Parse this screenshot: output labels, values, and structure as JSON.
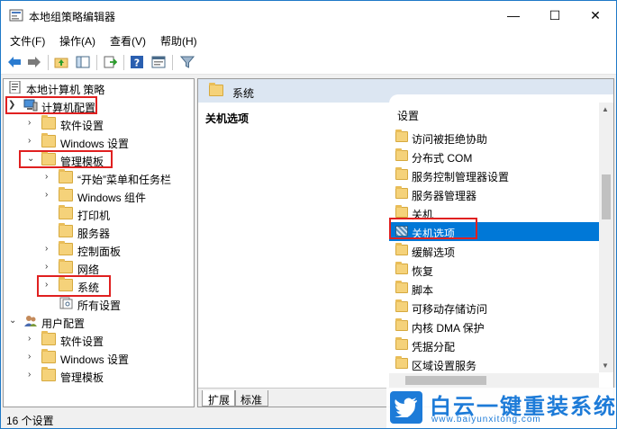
{
  "window": {
    "title": "本地组策略编辑器",
    "minimize": "—",
    "maximize": "☐",
    "close": "✕"
  },
  "menu": [
    "文件(F)",
    "操作(A)",
    "查看(V)",
    "帮助(H)"
  ],
  "toolbar": {
    "icons": [
      "back-icon",
      "forward-icon",
      "up-folder-icon",
      "show-hide-tree-icon",
      "export-list-icon",
      "help-icon",
      "properties-icon",
      "filter-icon"
    ]
  },
  "tree": {
    "root": "本地计算机 策略",
    "computer_config": "计算机配置",
    "software_settings": "软件设置",
    "windows_settings": "Windows 设置",
    "admin_templates": "管理模板",
    "start_menu": "“开始”菜单和任务栏",
    "windows_components": "Windows 组件",
    "printers": "打印机",
    "server": "服务器",
    "control_panel": "控制面板",
    "network": "网络",
    "system": "系统",
    "all_settings": "所有设置",
    "user_config": "用户配置",
    "user_software_settings": "软件设置",
    "user_windows_settings": "Windows 设置",
    "user_admin_templates": "管理模板"
  },
  "right": {
    "header": "系统",
    "section_title": "关机选项",
    "column_header": "设置",
    "items": [
      "访问被拒绝协助",
      "分布式 COM",
      "服务控制管理器设置",
      "服务器管理器",
      "关机",
      "关机选项",
      "缓解选项",
      "恢复",
      "脚本",
      "可移动存储访问",
      "内核 DMA 保护",
      "凭据分配",
      "区域设置服务"
    ],
    "selected_index": 5,
    "tabs": [
      "扩展",
      "标准"
    ],
    "active_tab": 0
  },
  "status": "16 个设置",
  "watermark": {
    "brand": "白云一键重装系统",
    "url": "www.baiyunxitong.com"
  },
  "colors": {
    "selection": "#0078d7",
    "highlight_box": "#e02020",
    "header_bar": "#dce6f2",
    "brand": "#1d7bd8"
  }
}
